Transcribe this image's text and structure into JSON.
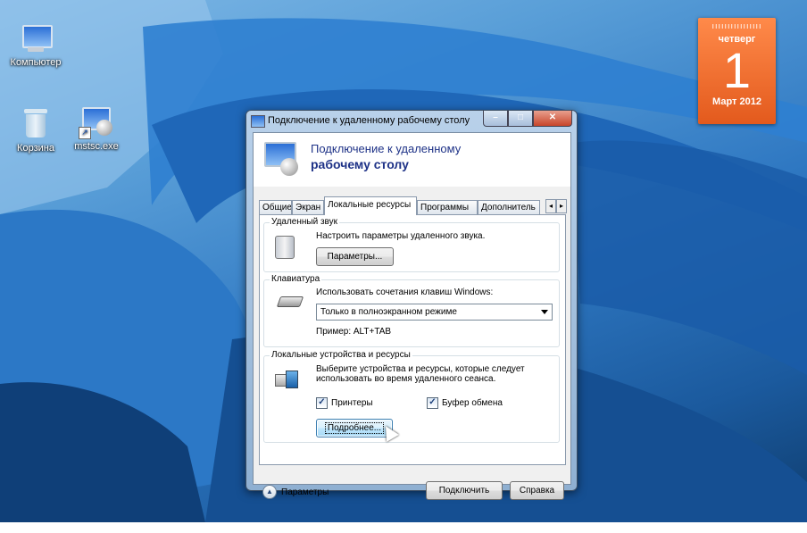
{
  "desktop": {
    "icons": [
      {
        "name": "computer",
        "label": "Компьютер"
      },
      {
        "name": "recycle-bin",
        "label": "Корзина"
      },
      {
        "name": "mstsc",
        "label": "mstsc.exe"
      }
    ],
    "calendar": {
      "weekday": "четверг",
      "day": "1",
      "month_year": "Март 2012"
    }
  },
  "window": {
    "title": "Подключение к удаленному рабочему столу",
    "header": {
      "line1": "Подключение к удаленному",
      "line2": "рабочему столу"
    },
    "tabs": [
      {
        "label": "Общие",
        "active": false
      },
      {
        "label": "Экран",
        "active": false
      },
      {
        "label": "Локальные ресурсы",
        "active": true
      },
      {
        "label": "Программы",
        "active": false
      },
      {
        "label": "Дополнитель",
        "active": false
      }
    ],
    "sound": {
      "group_label": "Удаленный звук",
      "description": "Настроить параметры удаленного звука.",
      "button": "Параметры..."
    },
    "keyboard": {
      "group_label": "Клавиатура",
      "description": "Использовать сочетания клавиш Windows:",
      "selected": "Только в полноэкранном режиме",
      "example": "Пример: ALT+TAB"
    },
    "devices": {
      "group_label": "Локальные устройства и ресурсы",
      "description_line1": "Выберите устройства и ресурсы, которые следует",
      "description_line2": "использовать во время удаленного сеанса.",
      "printers": {
        "label": "Принтеры",
        "checked": true
      },
      "clipboard": {
        "label": "Буфер обмена",
        "checked": true
      },
      "more_button": "Подробнее..."
    },
    "footer": {
      "options": "Параметры",
      "connect": "Подключить",
      "help": "Справка"
    }
  }
}
